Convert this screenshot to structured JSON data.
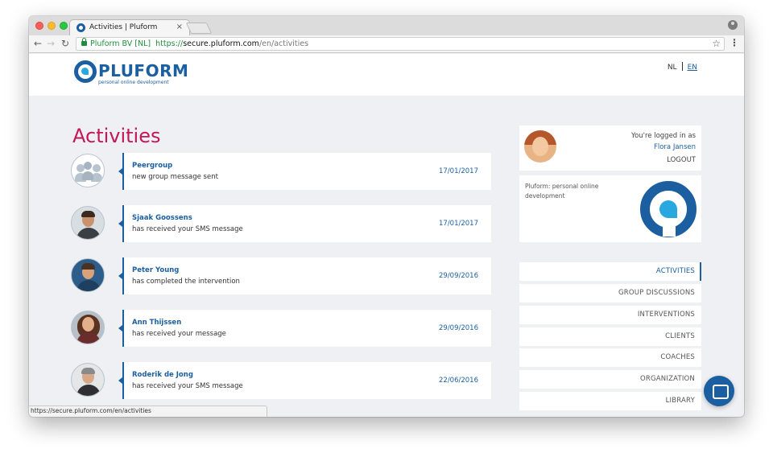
{
  "browser": {
    "tab_title": "Activities | Pluform",
    "tab_close": "×",
    "org_name": "Pluform BV [NL]",
    "url_scheme": "https://",
    "url_host": "secure.pluform.com",
    "url_path": "/en/activities",
    "status_url": "https://secure.pluform.com/en/activities"
  },
  "header": {
    "logo_text": "PLUFORM",
    "logo_tagline": "personal online development",
    "lang_nl": "NL",
    "lang_en": "EN"
  },
  "main": {
    "title": "Activities",
    "activities": [
      {
        "name": "Peergroup",
        "message": "new group message sent",
        "date": "17/01/2017",
        "avatar": "group-icon"
      },
      {
        "name": "Sjaak Goossens",
        "message": "has received your SMS message",
        "date": "17/01/2017",
        "avatar": "person-photo"
      },
      {
        "name": "Peter Young",
        "message": "has completed the intervention",
        "date": "29/09/2016",
        "avatar": "person-photo"
      },
      {
        "name": "Ann Thijssen",
        "message": "has received your message",
        "date": "29/09/2016",
        "avatar": "person-photo"
      },
      {
        "name": "Roderik de Jong",
        "message": "has received your SMS message",
        "date": "22/06/2016",
        "avatar": "person-photo"
      }
    ]
  },
  "sidebar": {
    "logged_in_label": "You're logged in as",
    "user_name": "Flora Jansen",
    "logout": "LOGOUT",
    "brand_text": "Pluform: personal online development",
    "nav": [
      {
        "label": "ACTIVITIES",
        "active": true
      },
      {
        "label": "GROUP DISCUSSIONS",
        "active": false
      },
      {
        "label": "INTERVENTIONS",
        "active": false
      },
      {
        "label": "CLIENTS",
        "active": false
      },
      {
        "label": "COACHES",
        "active": false
      },
      {
        "label": "ORGANIZATION",
        "active": false
      },
      {
        "label": "LIBRARY",
        "active": false
      }
    ]
  },
  "colors": {
    "brand_blue": "#1b5fa0",
    "accent_light_blue": "#29a8e0",
    "title_magenta": "#c2185b",
    "page_bg": "#eef0f3"
  }
}
